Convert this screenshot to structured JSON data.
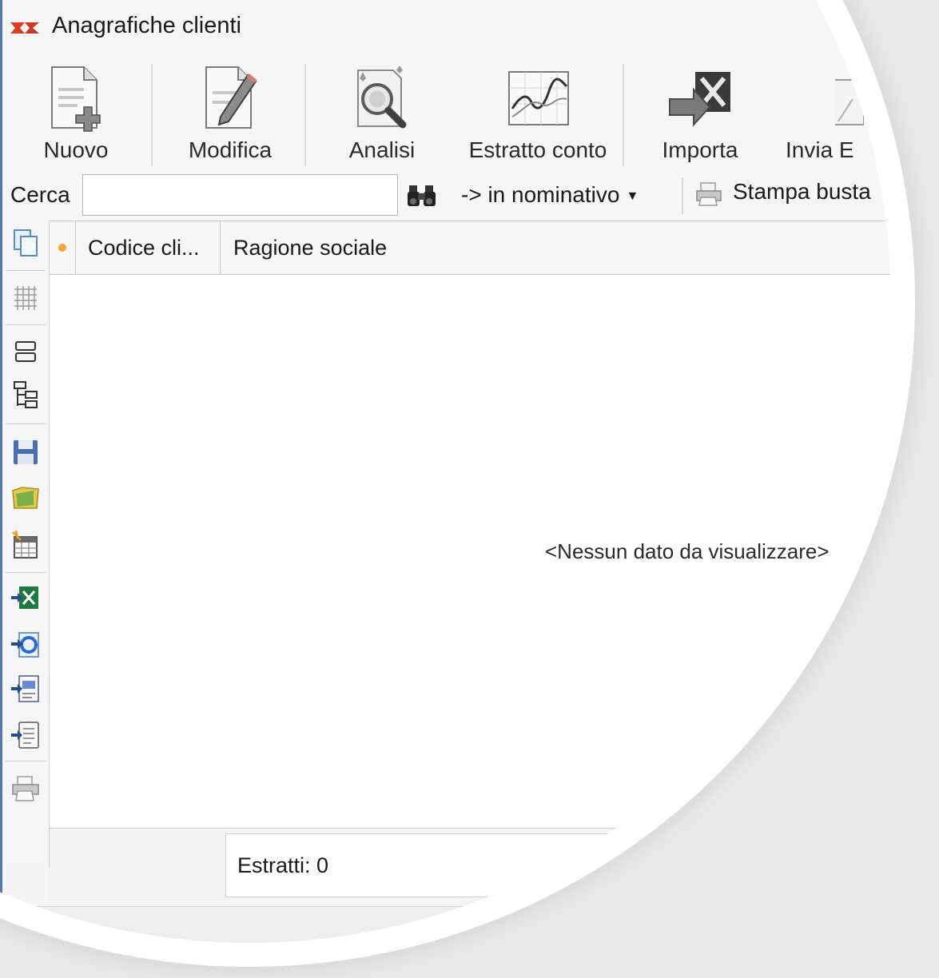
{
  "window": {
    "title": "Anagrafiche clienti"
  },
  "ribbon": {
    "new_label": "Nuovo",
    "edit_label": "Modifica",
    "analysis_label": "Analisi",
    "statement_label": "Estratto conto",
    "import_label": "Importa",
    "send_label": "Invia E"
  },
  "search": {
    "label": "Cerca",
    "value": "",
    "scope_label": "-> in nominativo",
    "print_envelope_label": "Stampa busta"
  },
  "grid": {
    "columns": [
      "Codice cli...",
      "Ragione sociale"
    ],
    "empty_message": "<Nessun dato da visualizzare>"
  },
  "footer": {
    "count_label": "Estratti: 0"
  },
  "sidebar": {
    "icons": [
      "copy-icon",
      "grid-icon",
      "layout-icon",
      "tree-icon",
      "save-icon",
      "open-folder-icon",
      "calendar-icon",
      "excel-export-icon",
      "web-export-icon",
      "document-export-icon",
      "list-export-icon",
      "print-icon"
    ]
  },
  "colors": {
    "accent": "#3a5a96",
    "indicator": "#f4a532",
    "frame": "#5a7ab4"
  }
}
